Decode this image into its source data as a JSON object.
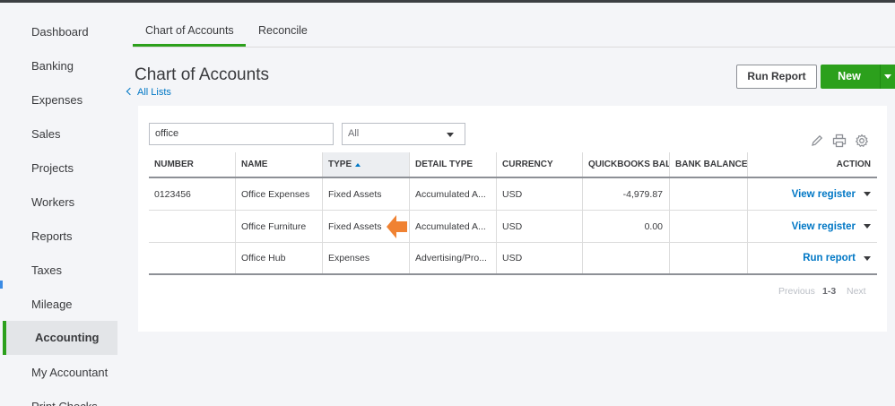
{
  "sidebar": {
    "items": [
      {
        "label": "Dashboard"
      },
      {
        "label": "Banking"
      },
      {
        "label": "Expenses"
      },
      {
        "label": "Sales"
      },
      {
        "label": "Projects"
      },
      {
        "label": "Workers"
      },
      {
        "label": "Reports"
      },
      {
        "label": "Taxes"
      },
      {
        "label": "Mileage"
      },
      {
        "label": "Accounting",
        "active": true
      },
      {
        "label": "My Accountant"
      },
      {
        "label": "Print Checks"
      }
    ]
  },
  "tabs": [
    {
      "label": "Chart of Accounts",
      "active": true
    },
    {
      "label": "Reconcile"
    }
  ],
  "header": {
    "title": "Chart of Accounts",
    "back_link": "All Lists",
    "run_report_label": "Run Report",
    "new_label": "New"
  },
  "filters": {
    "search_value": "office",
    "type_select": "All"
  },
  "toolbar_icons": [
    "pencil-icon",
    "print-icon",
    "gear-icon"
  ],
  "table": {
    "columns": [
      "NUMBER",
      "NAME",
      "TYPE",
      "DETAIL TYPE",
      "CURRENCY",
      "QUICKBOOKS BALA",
      "BANK BALANCE",
      "ACTION"
    ],
    "sorted_column": "TYPE",
    "rows": [
      {
        "number": "0123456",
        "name": "Office Expenses",
        "type": "Fixed Assets",
        "detail_type": "Accumulated A...",
        "currency": "USD",
        "qb_balance": "-4,979.87",
        "bank_balance": "",
        "action": "View register"
      },
      {
        "number": "",
        "name": "Office Furniture",
        "type": "Fixed Assets",
        "detail_type": "Accumulated A...",
        "currency": "USD",
        "qb_balance": "0.00",
        "bank_balance": "",
        "action": "View register"
      },
      {
        "number": "",
        "name": "Office Hub",
        "type": "Expenses",
        "detail_type": "Advertising/Pro...",
        "currency": "USD",
        "qb_balance": "",
        "bank_balance": "",
        "action": "Run report"
      }
    ]
  },
  "pagination": {
    "previous": "Previous",
    "range": "1-3",
    "next": "Next"
  },
  "colors": {
    "accent_green": "#2ca01c",
    "link_blue": "#0077c5",
    "annotation_orange": "#f08232"
  }
}
